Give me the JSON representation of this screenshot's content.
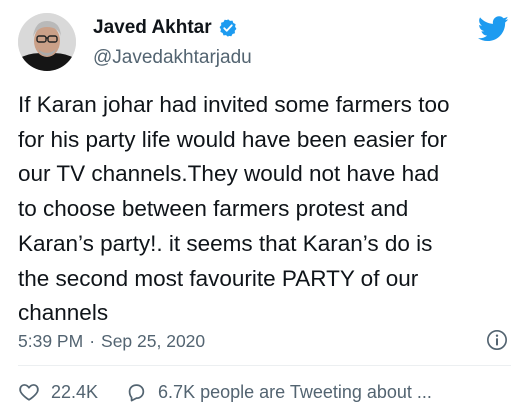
{
  "author": {
    "name": "Javed Akhtar",
    "handle": "@Javedakhtarjadu",
    "verified": true
  },
  "tweet": {
    "text": "If Karan johar had invited some farmers too\nfor his party life would have been easier for\nour TV channels.They would not have had\nto choose between farmers protest and\nKaran’s party!. it seems that Karan’s do is\nthe second most favourite PARTY of  our\nchannels",
    "time": "5:39 PM",
    "separator": "·",
    "date": "Sep 25, 2020"
  },
  "actions": {
    "likes": "22.4K",
    "conversation": "6.7K people are Tweeting about ..."
  },
  "icons": {
    "bird": "twitter-bird-icon",
    "verified": "verified-badge-icon",
    "info": "info-icon",
    "like": "heart-icon",
    "reply": "speech-bubble-icon"
  },
  "colors": {
    "brand": "#1d9bf0",
    "text": "#0f1419",
    "secondary": "#536471"
  }
}
